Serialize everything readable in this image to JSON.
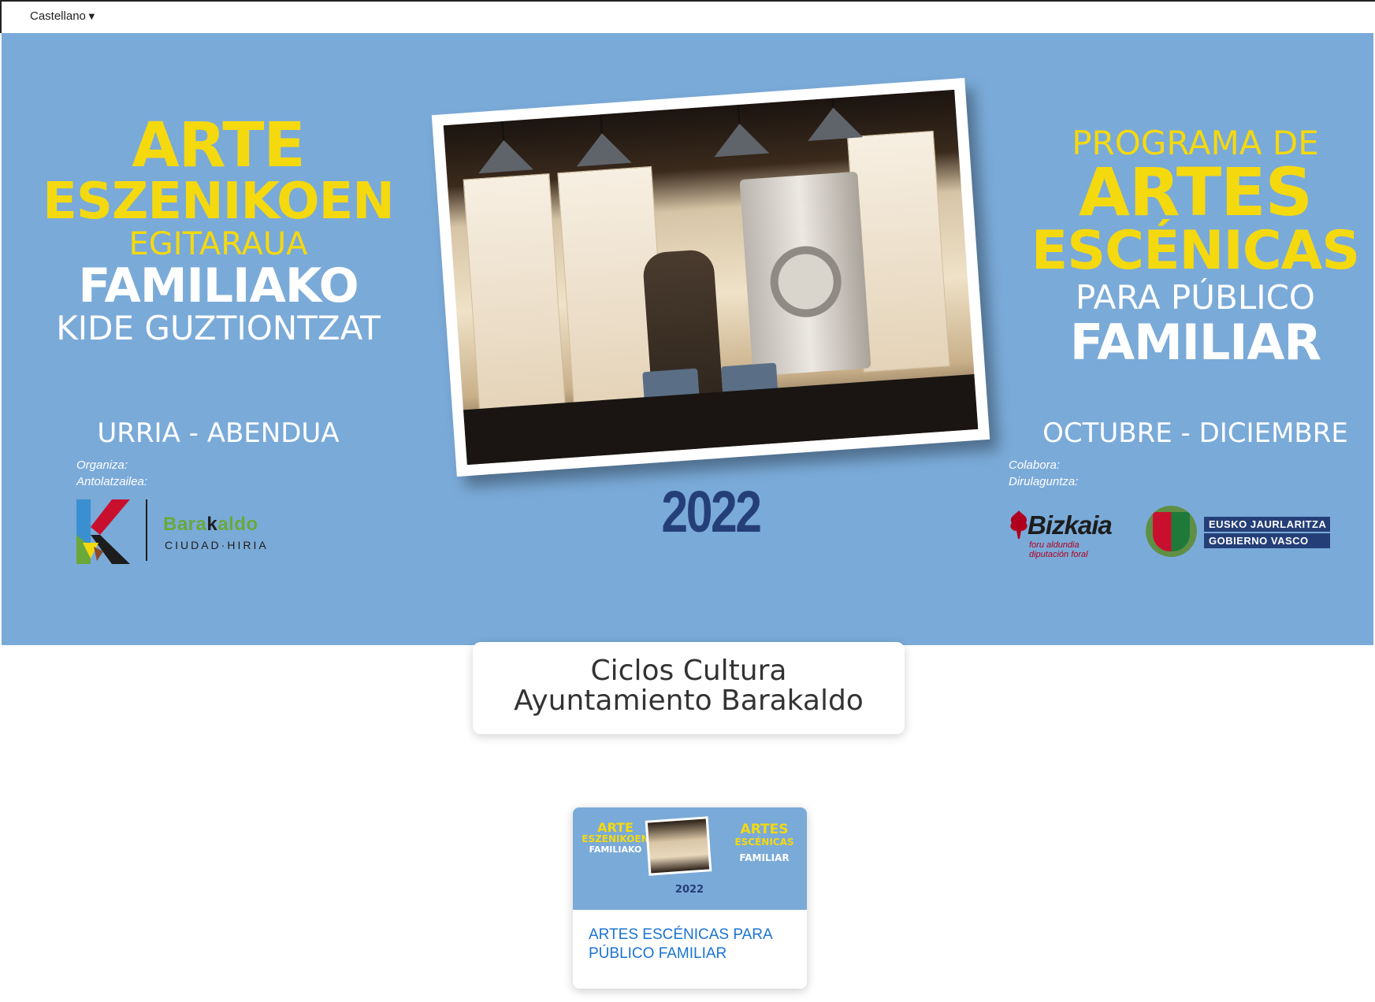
{
  "top_bar": {
    "language_label": "Castellano",
    "language_arrow": "▼"
  },
  "banner": {
    "left": {
      "line1": "ARTE",
      "line2": "ESZENIKOEN",
      "line3": "EGITARAUA",
      "line4": "FAMILIAKO",
      "line5": "KIDE GUZTIONTZAT",
      "dates": "URRIA - ABENDUA"
    },
    "right": {
      "line1": "PROGRAMA DE",
      "line2": "ARTES",
      "line3": "ESCÉNICAS",
      "line4": "PARA PÚBLICO",
      "line5": "FAMILIAR",
      "dates": "OCTUBRE - DICIEMBRE"
    },
    "year": "2022",
    "organizer_label_1": "Organiza:",
    "organizer_label_2": "Antolatzailea:",
    "organizer_logo": {
      "name_part1": "Bara",
      "name_part2": "k",
      "name_part3": "aldo",
      "subtitle": "CIUDAD·HIRIA"
    },
    "collaborator_label_1": "Colabora:",
    "collaborator_label_2": "Dirulaguntza:",
    "bizkaia_logo": {
      "name": "Bizkaia",
      "sub1": "foru aldundia",
      "sub2": "diputación foral"
    },
    "eusko_logo": {
      "line1": "EUSKO JAURLARITZA",
      "line2": "GOBIERNO VASCO"
    },
    "colors": {
      "background": "#7aaad8",
      "yellow": "#f5d90f",
      "year": "#243f78"
    }
  },
  "title_card": {
    "line1": "Ciclos Cultura",
    "line2": "Ayuntamiento Barakaldo"
  },
  "cards": [
    {
      "label": "ARTES ESCÉNICAS PARA PÚBLICO FAMILIAR",
      "thumbnail_icon": "poster-thumbnail"
    }
  ]
}
